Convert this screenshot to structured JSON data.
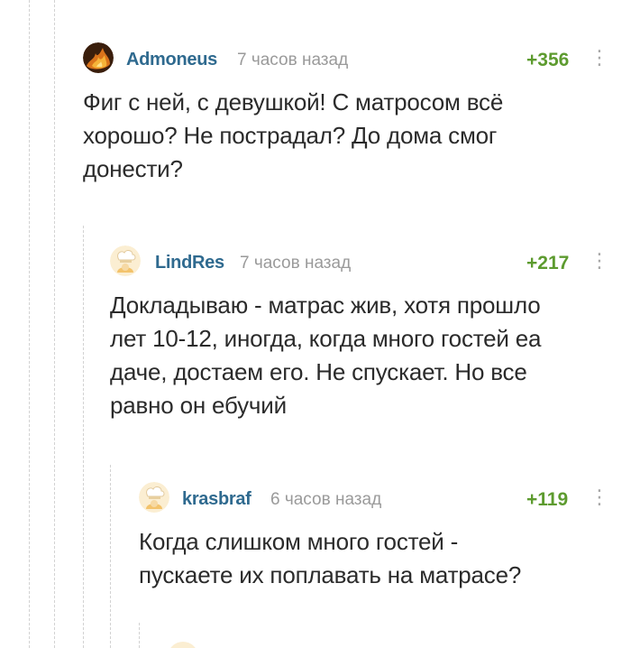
{
  "comments": [
    {
      "author": "Admoneus",
      "time": "7 часов назад",
      "rating": "+356",
      "more_glyph": "⋮",
      "lines": [
        "Фиг с ней, с девушкой! С матросом всё",
        "хорошо? Не пострадал? До дома смог",
        "донести?"
      ]
    },
    {
      "author": "LindRes",
      "time": "7 часов назад",
      "rating": "+217",
      "more_glyph": "⋮",
      "lines": [
        "Докладываю - матрас жив, хотя прошло",
        "лет 10-12, иногда, когда много гостей еа",
        "даче, достаем его. Не спускает. Но все",
        "равно он ебучий"
      ]
    },
    {
      "author": "krasbraf",
      "time": "6 часов назад",
      "rating": "+119",
      "more_glyph": "⋮",
      "lines": [
        "Когда слишком много гостей -",
        "пускаете их поплавать на матрасе?"
      ]
    }
  ],
  "colors": {
    "author": "#2f6a8f",
    "rating": "#5d9b2f",
    "time": "#9a9a9a",
    "text": "#2b2b2b",
    "thread_line": "#d2d2d2"
  },
  "icons": {
    "avatar_1": "fire-avatar-icon",
    "avatar_2": "default-chef-avatar-icon",
    "avatar_3": "default-chef-avatar-icon",
    "more": "more-vertical-icon"
  }
}
